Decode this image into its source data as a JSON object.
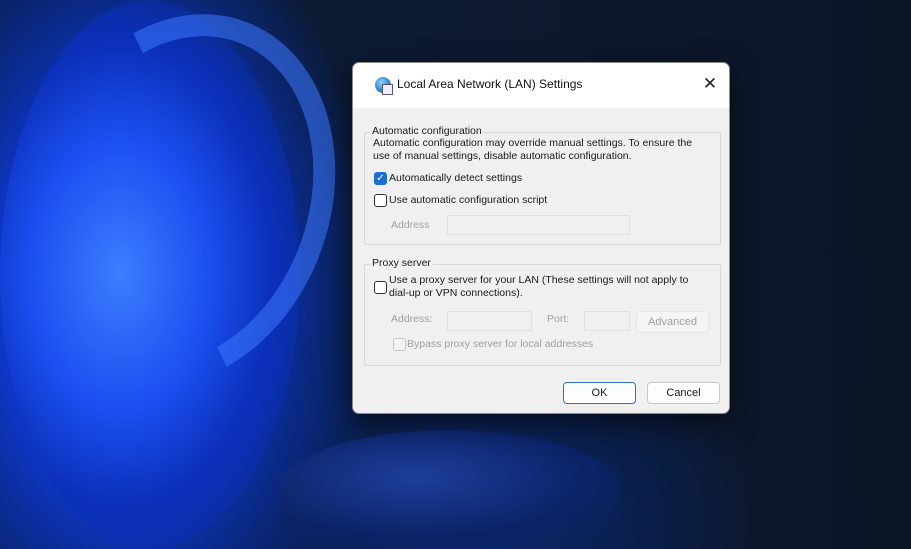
{
  "dialog": {
    "title": "Local Area Network (LAN) Settings",
    "title_icon": "globe-network-icon",
    "close_icon": "close-icon",
    "auto_config": {
      "label": "Automatic configuration",
      "description_line1": "Automatic configuration may override manual settings.  To ensure the",
      "description_line2": "use of manual settings, disable automatic configuration.",
      "auto_detect": {
        "label": "Automatically detect settings",
        "checked": true
      },
      "use_script": {
        "label": "Use automatic configuration script",
        "checked": false
      },
      "address_label": "Address",
      "address_value": ""
    },
    "proxy": {
      "label": "Proxy server",
      "use_proxy": {
        "label_line1": "Use a proxy server for your LAN (These settings will not apply to",
        "label_line2": "dial-up or VPN connections).",
        "checked": false
      },
      "address_label": "Address:",
      "address_value": "",
      "port_label": "Port:",
      "port_value": "",
      "advanced_label": "Advanced",
      "bypass": {
        "label": "Bypass proxy server for local addresses",
        "checked": false
      }
    },
    "ok_label": "OK",
    "cancel_label": "Cancel"
  }
}
